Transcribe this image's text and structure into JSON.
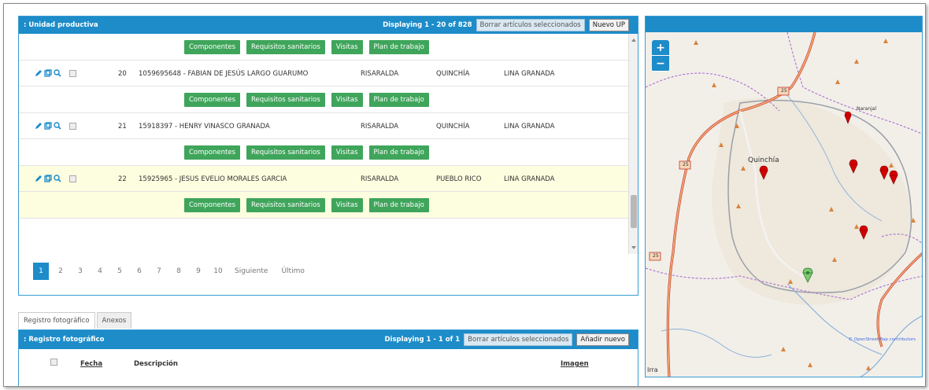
{
  "panel_top": {
    "title": ": Unidad productiva",
    "displaying": "Displaying 1 - 20 of 828",
    "delete_selected": "Borrar artículos seleccionados",
    "new_button": "Nuevo UP"
  },
  "action_buttons": [
    "Componentes",
    "Requisitos sanitarios",
    "Visitas",
    "Plan de trabajo"
  ],
  "rows": [
    {
      "num": "20",
      "name": "1059695648 - FABIAN DE JESÚS LARGO GUARUMO",
      "dept": "RISARALDA",
      "mun": "QUINCHÍA",
      "line": "LINA GRANADA",
      "highlight": false
    },
    {
      "num": "21",
      "name": "15918397 - HENRY VINASCO GRANADA",
      "dept": "RISARALDA",
      "mun": "QUINCHÍA",
      "line": "LINA GRANADA",
      "highlight": false
    },
    {
      "num": "22",
      "name": "15925965 - JESUS EVELIO MORALES GARCIA",
      "dept": "RISARALDA",
      "mun": "PUEBLO RICO",
      "line": "LINA GRANADA",
      "highlight": true
    }
  ],
  "pager": {
    "pages": [
      "1",
      "2",
      "3",
      "4",
      "5",
      "6",
      "7",
      "8",
      "9",
      "10"
    ],
    "next": "Siguiente",
    "last": "Último",
    "active": "1"
  },
  "tabs": [
    "Registro fotográfico",
    "Anexos"
  ],
  "panel_bottom": {
    "title": ": Registro fotográfico",
    "displaying": "Displaying 1 - 1 of 1",
    "delete_selected": "Borrar artículos seleccionados",
    "new_button": "Añadir nuevo",
    "columns": {
      "date": "Fecha",
      "desc": "Descripción",
      "image": "Imagen"
    }
  },
  "map": {
    "zoom_in": "+",
    "zoom_out": "−",
    "town_label": "Quinchía",
    "place_label": "Naranjal",
    "road_25": "25",
    "attribution": "© OpenStreetMap contributors",
    "bottom_label": "Irra"
  },
  "colors": {
    "header_blue": "#1d8cc9",
    "button_green": "#3fa55b",
    "highlight_row": "#fdfde0",
    "marker_red": "#d40000",
    "marker_green": "#7ec870"
  }
}
